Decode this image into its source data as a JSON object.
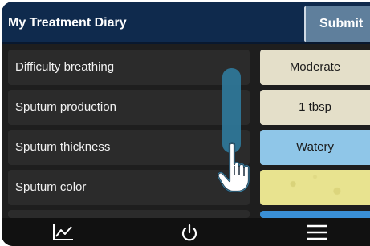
{
  "header": {
    "title": "My Treatment Diary",
    "submit_label": "Submit"
  },
  "rows": [
    {
      "label": "Difficulty breathing",
      "value": "Moderate",
      "state": "normal"
    },
    {
      "label": "Sputum production",
      "value": "1 tbsp",
      "state": "normal"
    },
    {
      "label": "Sputum thickness",
      "value": "Watery",
      "state": "selected"
    },
    {
      "label": "Sputum color",
      "value": "",
      "state": "color-swatch-yellow"
    }
  ],
  "colors": {
    "header_bg": "#0f2a4d",
    "submit_bg": "#5f7f9c",
    "selected_value": "#8fc6e8",
    "value_bg": "#e4dfc9",
    "yellow_swatch": "#e8e38f",
    "scrollbar": "#2f7a9c"
  },
  "footer": {
    "icons": [
      "chart-icon",
      "power-icon",
      "menu-icon"
    ]
  }
}
